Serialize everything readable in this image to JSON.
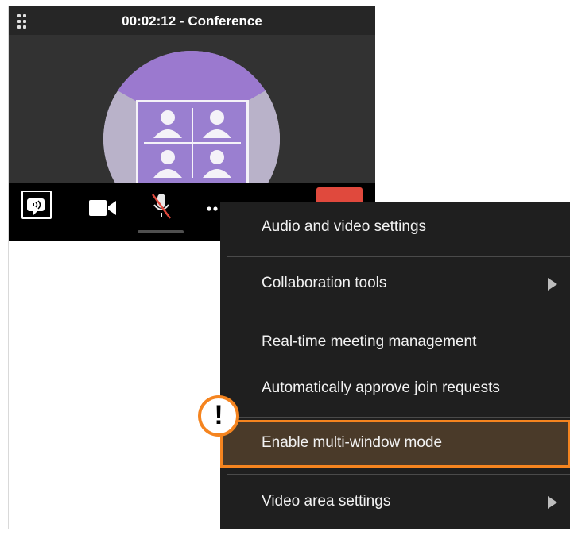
{
  "call": {
    "title": "00:02:12 - Conference",
    "colors": {
      "window_bg": "#323232",
      "title_bar_bg": "#262626",
      "toolbar_bg": "#000000",
      "avatar_circle": "#b9b2c9",
      "avatar_top": "#9b79cf",
      "hangup": "#e0493d"
    },
    "toolbar": {
      "buttons": [
        "speaker-icon",
        "video-camera-icon",
        "microphone-muted-icon",
        "more-icon",
        "hang-up-button"
      ]
    }
  },
  "menu": {
    "items": [
      {
        "label": "Audio and video settings",
        "has_submenu": false
      },
      {
        "label": "Collaboration tools",
        "has_submenu": true
      },
      {
        "label": "Real-time meeting management",
        "has_submenu": false
      },
      {
        "label": "Automatically approve join requests",
        "has_submenu": false
      },
      {
        "label": "Enable multi-window mode",
        "has_submenu": false,
        "highlighted": true
      },
      {
        "label": "Video area settings",
        "has_submenu": true
      }
    ],
    "colors": {
      "bg": "#1f1f1f",
      "highlight_bg": "#4a3a29",
      "highlight_border": "#f5841f"
    }
  },
  "callout": {
    "symbol": "!",
    "color": "#f5841f"
  }
}
